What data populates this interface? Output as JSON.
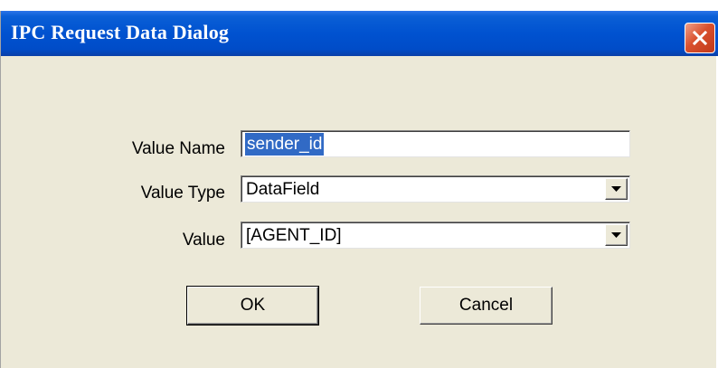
{
  "window": {
    "title": "IPC Request Data Dialog",
    "close_icon": "close-x-icon"
  },
  "form": {
    "value_name": {
      "label": "Value Name",
      "value": "sender_id"
    },
    "value_type": {
      "label": "Value Type",
      "selected": "DataField"
    },
    "value": {
      "label": "Value",
      "selected": "[AGENT_ID]"
    }
  },
  "buttons": {
    "ok": "OK",
    "cancel": "Cancel"
  },
  "colors": {
    "titlebar": "#0052d0",
    "dialog_background": "#ece9d8",
    "selection": "#316ac5",
    "close_button": "#d9502d"
  }
}
